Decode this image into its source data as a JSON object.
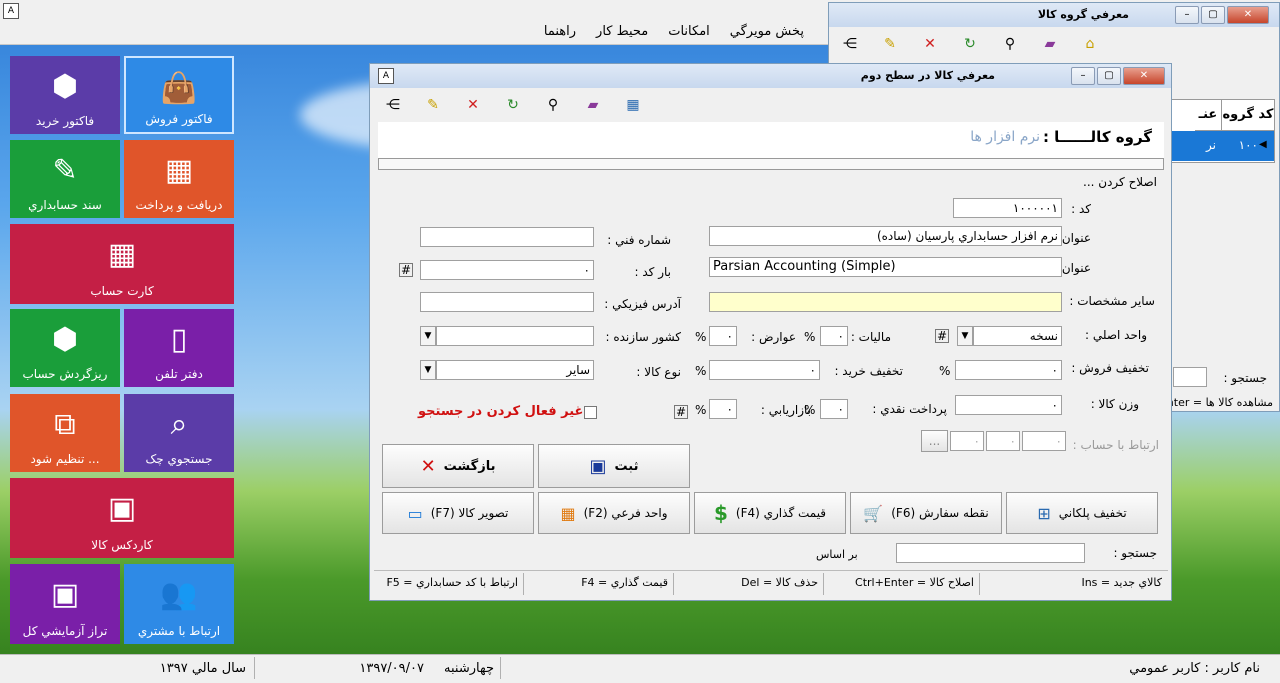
{
  "menu": {
    "items": [
      "پخش مويرگي",
      "امکانات",
      "محيط کار",
      "راهنما"
    ]
  },
  "tiles": {
    "sales_invoice": "فاکتور فروش",
    "purchase_invoice": "فاکتور خريد",
    "receipt_payment": "دريافت و پرداخت",
    "accounting_doc": "سند حسابداري",
    "account_card": "کارت حساب",
    "phonebook": "دفتر تلفن",
    "account_turnover": "ريزگردش حساب",
    "cheque_search": "جستجوي چک",
    "settle": "تنظيم شود ...",
    "item_kardex": "کاردکس کالا",
    "customer_contact": "ارتباط با مشتري",
    "trial_balance": "تراز آزمايشي کل"
  },
  "groupwin": {
    "title": "معرفي گروه کالا",
    "col_code": "کد گروه",
    "col_title": "عنـ",
    "row_code": "۱۰۰",
    "row_title": "نر",
    "search_label": "جستجو :",
    "footer": "مشاهده کالا ها = Enter"
  },
  "itemwin": {
    "title": "معرفي کالا در سطح دوم",
    "group_label": "گروه کالــــــا :",
    "group_value": "نرم افزار ها",
    "mode": "اصلاح کردن ...",
    "code_label": "کد :",
    "code_value": "۱۰۰۰۰۰۱",
    "title_label": "عنوان کالا :",
    "title_value": "نرم افزار حسابداري پارسيان (ساده)",
    "tech_label": "شماره فني :",
    "tech_value": "",
    "latin_label": "عنوان لاتين :",
    "latin_value": "Parsian Accounting (Simple)",
    "barcode_label": "بار کد :",
    "barcode_value": "۰",
    "other_label": "ساير مشخصات :",
    "address_label": "آدرس فيزيکي :",
    "unit_label": "واحد اصلي :",
    "unit_value": "نسخه",
    "tax_label": "ماليات :",
    "tax_value": "۰",
    "duties_label": "عوارض :",
    "duties_value": "۰",
    "country_label": "کشور سازنده :",
    "country_value": "",
    "salesdisc_label": "تخفيف فروش :",
    "salesdisc_value": "۰",
    "buydisc_label": "تخفيف خريد :",
    "buydisc_value": "۰",
    "type_label": "نوع کالا :",
    "type_value": "ساير",
    "weight_label": "وزن کالا :",
    "weight_value": "۰",
    "cashpay_label": "پرداخت نقدي :",
    "cashpay_value": "۰",
    "marketing_label": "بازاريابي :",
    "marketing_value": "۰",
    "disable_search": "غير فعال کردن در جستجو",
    "account_link_label": "ارتباط با حساب :",
    "account_link_values": [
      "۰",
      "۰",
      "۰"
    ],
    "account_dots": "...",
    "percent": "%",
    "save": "ثبت",
    "back": "بازگشت",
    "btn_tiered": "تخفيف پلکاني",
    "btn_reorder": "نقطه سفارش (F6)",
    "btn_pricing": "قيمت گذاري (F4)",
    "btn_subunit": "واحد فرعي (F2)",
    "btn_image": "تصوير کالا (F7)",
    "search_label": "جستجو :",
    "based_on": "بر اساس",
    "sb_new": "کالاي جديد = Ins",
    "sb_edit": "اصلاح کالا = Ctrl+Enter",
    "sb_delete": "حذف کالا = Del",
    "sb_price": "قيمت گذاري = F4",
    "sb_link": "ارتباط با کد حسابداري = F5"
  },
  "status": {
    "user": "نام کاربر : کاربر عمومي",
    "day": "چهارشنبه",
    "date": "۱۳۹۷/۰۹/۰۷",
    "fiscal": "سال مالي ۱۳۹۷"
  }
}
